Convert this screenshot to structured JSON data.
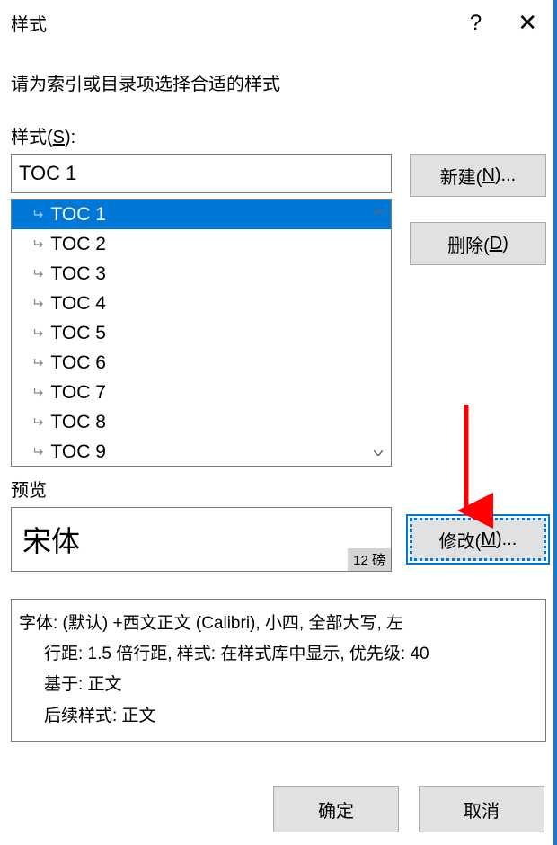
{
  "title_bar": {
    "title": "样式",
    "help": "?",
    "close": "✕"
  },
  "prompt": "请为索引或目录项选择合适的样式",
  "styles_label_prefix": "样式(",
  "styles_label_key": "S",
  "styles_label_suffix": "):",
  "selected_style": "TOC 1",
  "styles": [
    {
      "label": "TOC 1",
      "selected": true
    },
    {
      "label": "TOC 2",
      "selected": false
    },
    {
      "label": "TOC 3",
      "selected": false
    },
    {
      "label": "TOC 4",
      "selected": false
    },
    {
      "label": "TOC 5",
      "selected": false
    },
    {
      "label": "TOC 6",
      "selected": false
    },
    {
      "label": "TOC 7",
      "selected": false
    },
    {
      "label": "TOC 8",
      "selected": false
    },
    {
      "label": "TOC 9",
      "selected": false
    }
  ],
  "buttons": {
    "new_prefix": "新建(",
    "new_key": "N",
    "new_suffix": ")...",
    "delete_prefix": "删除(",
    "delete_key": "D",
    "delete_suffix": ")",
    "modify_prefix": "修改(",
    "modify_key": "M",
    "modify_suffix": ")...",
    "ok": "确定",
    "cancel": "取消"
  },
  "preview_label": "预览",
  "preview_font": "宋体",
  "preview_size": "12 磅",
  "description": {
    "line1": "字体: (默认) +西文正文 (Calibri), 小四, 全部大写, 左",
    "line2": "行距: 1.5 倍行距, 样式: 在样式库中显示, 优先级: 40",
    "line3": "基于: 正文",
    "line4": "后续样式: 正文"
  }
}
